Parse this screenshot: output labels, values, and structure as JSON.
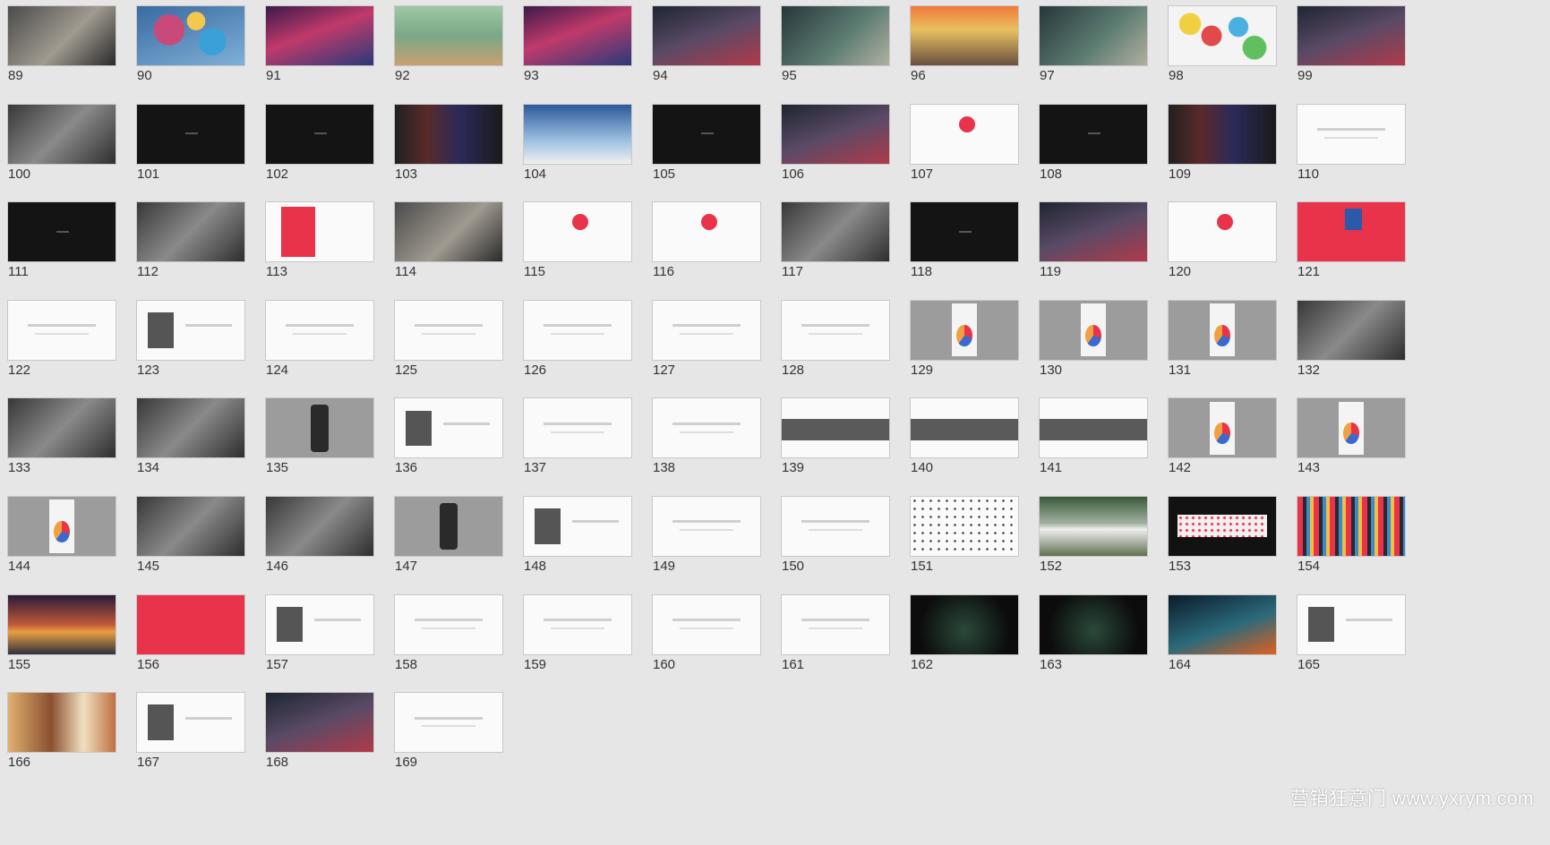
{
  "watermark": "营销狂意门 www.yxrym.com",
  "slides": [
    {
      "n": "89",
      "k": "k-photo-a"
    },
    {
      "n": "90",
      "k": "k-photo-b"
    },
    {
      "n": "91",
      "k": "k-photo-c"
    },
    {
      "n": "92",
      "k": "k-photo-d"
    },
    {
      "n": "93",
      "k": "k-photo-c"
    },
    {
      "n": "94",
      "k": "k-photo-g"
    },
    {
      "n": "95",
      "k": "k-photo-e"
    },
    {
      "n": "96",
      "k": "k-photo-f"
    },
    {
      "n": "97",
      "k": "k-photo-e"
    },
    {
      "n": "98",
      "k": "k-photo-h"
    },
    {
      "n": "99",
      "k": "k-photo-g"
    },
    {
      "n": "100",
      "k": "k-photo-i"
    },
    {
      "n": "101",
      "k": "k-black"
    },
    {
      "n": "102",
      "k": "k-black"
    },
    {
      "n": "103",
      "k": "k-neon"
    },
    {
      "n": "104",
      "k": "k-sky"
    },
    {
      "n": "105",
      "k": "k-black"
    },
    {
      "n": "106",
      "k": "k-photo-g"
    },
    {
      "n": "107",
      "k": "k-white-pin"
    },
    {
      "n": "108",
      "k": "k-black"
    },
    {
      "n": "109",
      "k": "k-neon"
    },
    {
      "n": "110",
      "k": "k-white"
    },
    {
      "n": "111",
      "k": "k-black"
    },
    {
      "n": "112",
      "k": "k-photo-i"
    },
    {
      "n": "113",
      "k": "k-white-d2"
    },
    {
      "n": "114",
      "k": "k-photo-a"
    },
    {
      "n": "115",
      "k": "k-white-pin"
    },
    {
      "n": "116",
      "k": "k-white-pin"
    },
    {
      "n": "117",
      "k": "k-photo-i"
    },
    {
      "n": "118",
      "k": "k-black"
    },
    {
      "n": "119",
      "k": "k-photo-g"
    },
    {
      "n": "120",
      "k": "k-white-pin"
    },
    {
      "n": "121",
      "k": "k-red-num"
    },
    {
      "n": "122",
      "k": "k-white"
    },
    {
      "n": "123",
      "k": "k-white-step"
    },
    {
      "n": "124",
      "k": "k-white"
    },
    {
      "n": "125",
      "k": "k-white"
    },
    {
      "n": "126",
      "k": "k-white"
    },
    {
      "n": "127",
      "k": "k-white"
    },
    {
      "n": "128",
      "k": "k-white"
    },
    {
      "n": "129",
      "k": "k-gray"
    },
    {
      "n": "130",
      "k": "k-gray"
    },
    {
      "n": "131",
      "k": "k-gray"
    },
    {
      "n": "132",
      "k": "k-photo-i"
    },
    {
      "n": "133",
      "k": "k-photo-i"
    },
    {
      "n": "134",
      "k": "k-photo-i"
    },
    {
      "n": "135",
      "k": "k-gray-phone"
    },
    {
      "n": "136",
      "k": "k-white-step"
    },
    {
      "n": "137",
      "k": "k-white"
    },
    {
      "n": "138",
      "k": "k-white"
    },
    {
      "n": "139",
      "k": "k-dark-gray-band"
    },
    {
      "n": "140",
      "k": "k-dark-gray-band"
    },
    {
      "n": "141",
      "k": "k-dark-gray-band"
    },
    {
      "n": "142",
      "k": "k-gray"
    },
    {
      "n": "143",
      "k": "k-gray"
    },
    {
      "n": "144",
      "k": "k-gray"
    },
    {
      "n": "145",
      "k": "k-photo-i"
    },
    {
      "n": "146",
      "k": "k-photo-i"
    },
    {
      "n": "147",
      "k": "k-gray-phone"
    },
    {
      "n": "148",
      "k": "k-white-step"
    },
    {
      "n": "149",
      "k": "k-white"
    },
    {
      "n": "150",
      "k": "k-white"
    },
    {
      "n": "151",
      "k": "k-confetti"
    },
    {
      "n": "152",
      "k": "k-billboard"
    },
    {
      "n": "153",
      "k": "k-banner-dark"
    },
    {
      "n": "154",
      "k": "k-stripe"
    },
    {
      "n": "155",
      "k": "k-city"
    },
    {
      "n": "156",
      "k": "k-red"
    },
    {
      "n": "157",
      "k": "k-white-step"
    },
    {
      "n": "158",
      "k": "k-white"
    },
    {
      "n": "159",
      "k": "k-white"
    },
    {
      "n": "160",
      "k": "k-white"
    },
    {
      "n": "161",
      "k": "k-white"
    },
    {
      "n": "162",
      "k": "k-dark-green"
    },
    {
      "n": "163",
      "k": "k-dark-green"
    },
    {
      "n": "164",
      "k": "k-night"
    },
    {
      "n": "165",
      "k": "k-white-step"
    },
    {
      "n": "166",
      "k": "k-food"
    },
    {
      "n": "167",
      "k": "k-white-step"
    },
    {
      "n": "168",
      "k": "k-photo-g"
    },
    {
      "n": "169",
      "k": "k-white"
    }
  ]
}
